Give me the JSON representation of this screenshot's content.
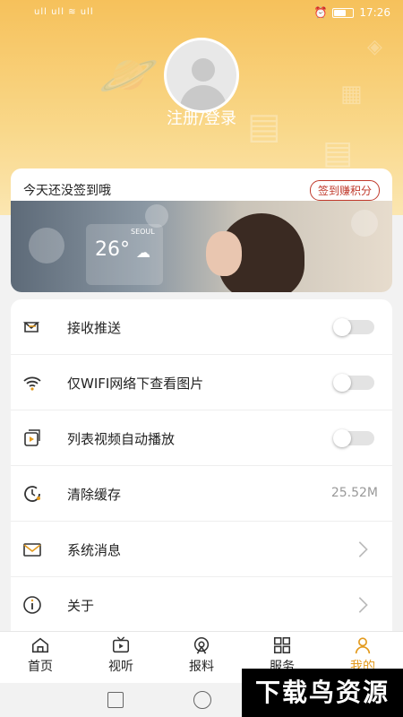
{
  "status_bar": {
    "left_text": "ull ull ≋ ull",
    "time": "17:26",
    "battery_pct": "65"
  },
  "profile": {
    "login_label": "注册/登录"
  },
  "checkin": {
    "text": "今天还没签到哦",
    "button": "签到赚积分"
  },
  "banner": {
    "city": "SEOUL",
    "temperature": "26°"
  },
  "settings": [
    {
      "label": "接收推送",
      "control": "toggle",
      "on": false,
      "icon": "message-icon"
    },
    {
      "label": "仅WIFI网络下查看图片",
      "control": "toggle",
      "on": false,
      "icon": "wifi-icon"
    },
    {
      "label": "列表视频自动播放",
      "control": "toggle",
      "on": false,
      "icon": "video-play-icon"
    },
    {
      "label": "清除缓存",
      "control": "value",
      "value": "25.52M",
      "icon": "clock-icon"
    },
    {
      "label": "系统消息",
      "control": "chevron",
      "icon": "mail-icon"
    },
    {
      "label": "关于",
      "control": "chevron",
      "icon": "info-icon"
    }
  ],
  "tabs": [
    {
      "label": "首页",
      "icon": "home-icon"
    },
    {
      "label": "视听",
      "icon": "tv-icon"
    },
    {
      "label": "报料",
      "icon": "broadcast-icon"
    },
    {
      "label": "服务",
      "icon": "grid-icon"
    },
    {
      "label": "我的",
      "icon": "person-icon",
      "active": true
    }
  ],
  "watermark": "下载鸟资源",
  "colors": {
    "accent": "#e39a1d",
    "header": "#f6c15b",
    "checkin_red": "#c0392b"
  }
}
